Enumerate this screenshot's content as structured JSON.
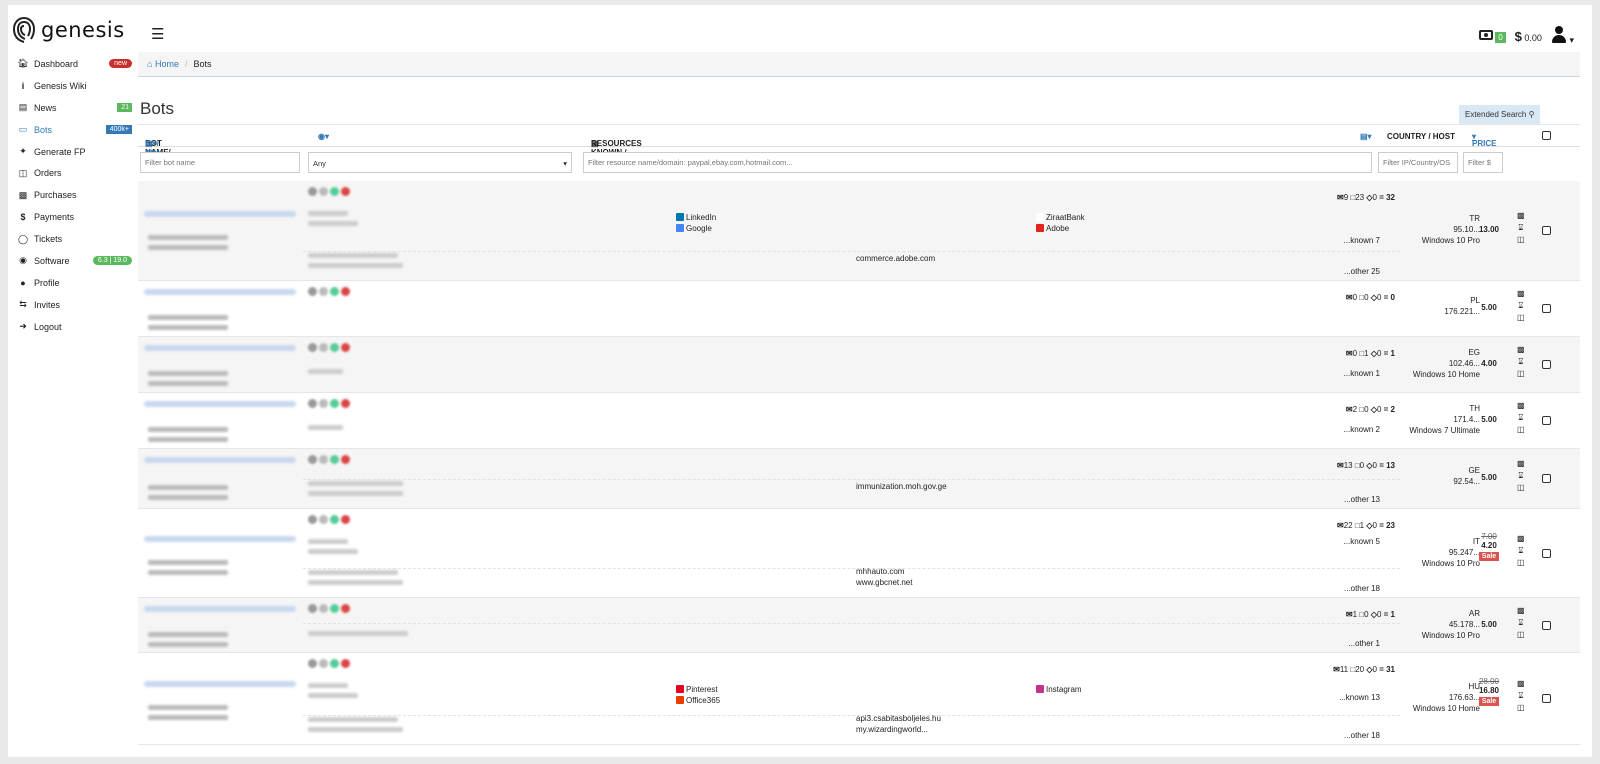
{
  "brand": {
    "name": "genesis"
  },
  "topbar": {
    "cash_badge": "0",
    "balance": "0.00",
    "currency": "$"
  },
  "sidebar": {
    "items": [
      {
        "label": "Dashboard",
        "icon": "home-icon",
        "badge": "new",
        "badge_color": "red"
      },
      {
        "label": "Genesis Wiki",
        "icon": "info-icon"
      },
      {
        "label": "News",
        "icon": "newspaper-icon",
        "badge": "21",
        "badge_color": "green"
      },
      {
        "label": "Bots",
        "icon": "laptop-icon",
        "badge": "400k+",
        "badge_color": "blue",
        "active": true
      },
      {
        "label": "Generate FP",
        "icon": "magic-wand-icon"
      },
      {
        "label": "Orders",
        "icon": "basket-icon"
      },
      {
        "label": "Purchases",
        "icon": "money-icon"
      },
      {
        "label": "Payments",
        "icon": "dollar-icon"
      },
      {
        "label": "Tickets",
        "icon": "comment-icon"
      },
      {
        "label": "Software",
        "icon": "gamepad-icon",
        "badge": "6.3 | 19.0",
        "badge_color": "green"
      },
      {
        "label": "Profile",
        "icon": "user-icon"
      },
      {
        "label": "Invites",
        "icon": "retweet-icon"
      },
      {
        "label": "Logout",
        "icon": "sign-out-icon"
      }
    ]
  },
  "breadcrumb": {
    "home": "Home",
    "current": "Bots"
  },
  "page": {
    "title": "Bots",
    "extended_search": "Extended Search"
  },
  "table": {
    "headers": {
      "bot_name": "BOT NAME/",
      "resources": "RESOURCES KNOWN / OTHER",
      "country": "COUNTRY / HOST",
      "price": "PRICE"
    },
    "filters": {
      "bot_name": "Filter bot name",
      "any": "Any",
      "resource": "Filter resource name/domain: paypal,ebay.com,hotmail.com...",
      "ip": "Filter IP/Country/OS",
      "price": "Filter $"
    },
    "rows": [
      {
        "stats": {
          "a": "9",
          "b": "23",
          "c": "0",
          "total": "32"
        },
        "known": "...known 7",
        "other": "...other 25",
        "known_left": [
          "LinkedIn",
          "Google"
        ],
        "known_right": [
          "ZiraatBank",
          "Adobe"
        ],
        "other_items": [
          "commerce.adobe.com"
        ],
        "country": "TR",
        "ip": "95.10...",
        "os": "Windows 10 Pro",
        "price": "13.00"
      },
      {
        "stats": {
          "a": "0",
          "b": "0",
          "c": "0",
          "total": "0"
        },
        "country": "PL",
        "ip": "176.221...",
        "os": "",
        "price": "5.00"
      },
      {
        "stats": {
          "a": "0",
          "b": "1",
          "c": "0",
          "total": "1"
        },
        "known": "...known 1",
        "country": "EG",
        "ip": "102.46...",
        "os": "Windows 10 Home",
        "price": "4.00"
      },
      {
        "stats": {
          "a": "2",
          "b": "0",
          "c": "0",
          "total": "2"
        },
        "known": "...known 2",
        "country": "TH",
        "ip": "171.4...",
        "os": "Windows 7 Ultimate",
        "price": "5.00"
      },
      {
        "stats": {
          "a": "13",
          "b": "0",
          "c": "0",
          "total": "13"
        },
        "other": "...other 13",
        "other_items": [
          "immunization.moh.gov.ge"
        ],
        "country": "GE",
        "ip": "92.54...",
        "os": "",
        "price": "5.00"
      },
      {
        "stats": {
          "a": "22",
          "b": "1",
          "c": "0",
          "total": "23"
        },
        "known": "...known 5",
        "other": "...other 18",
        "other_items": [
          "mhhauto.com",
          "www.gbcnet.net"
        ],
        "country": "IT",
        "ip": "95.247...",
        "os": "Windows 10 Pro",
        "old_price": "7.00",
        "price": "4.20",
        "sale": "Sale"
      },
      {
        "stats": {
          "a": "1",
          "b": "0",
          "c": "0",
          "total": "1"
        },
        "other": "...other 1",
        "country": "AR",
        "ip": "45.178...",
        "os": "Windows 10 Pro",
        "price": "5.00"
      },
      {
        "stats": {
          "a": "11",
          "b": "20",
          "c": "0",
          "total": "31"
        },
        "known": "...known 13",
        "other": "...other 18",
        "known_left": [
          "Pinterest",
          "Office365"
        ],
        "known_right": [
          "Instagram"
        ],
        "other_items": [
          "api3.csabitasboljeles.hu",
          "my.wizardingworld..."
        ],
        "country": "HU",
        "ip": "176.63...",
        "os": "Windows 10 Home",
        "old_price": "28.00",
        "price": "16.80",
        "sale": "Sale"
      }
    ]
  }
}
